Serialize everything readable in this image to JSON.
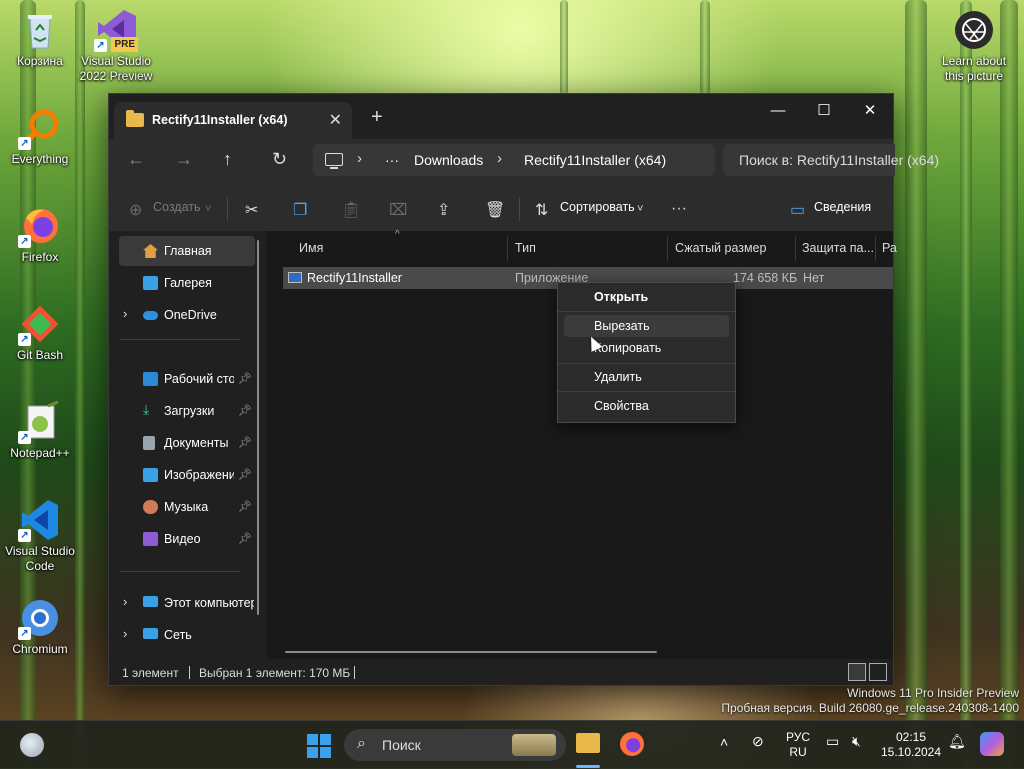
{
  "desktop": {
    "icons": [
      {
        "label": "Корзина"
      },
      {
        "label": "Visual Studio 2022 Preview",
        "badge": "PRE"
      },
      {
        "label": "Everything"
      },
      {
        "label": "Firefox"
      },
      {
        "label": "Git Bash"
      },
      {
        "label": "Notepad++"
      },
      {
        "label": "Visual Studio Code"
      },
      {
        "label": "Chromium"
      },
      {
        "label": "Learn about this picture"
      }
    ],
    "watermark": {
      "line1": "Windows 11 Pro Insider Preview",
      "line2": "Пробная версия. Build 26080.ge_release.240308-1400"
    }
  },
  "window": {
    "tab_title": "Rectify11Installer (x64)",
    "tab_close": "✕",
    "new_tab": "+",
    "controls": {
      "minimize": "—",
      "maximize": "☐",
      "close": "✕"
    },
    "nav": {
      "back": "←",
      "forward": "→",
      "up": "↑",
      "refresh": "↻"
    },
    "breadcrumb": [
      "Downloads",
      "Rectify11Installer (x64)"
    ],
    "breadcrumb_more": "···",
    "search_placeholder": "Поиск в: Rectify11Installer (x64)",
    "toolbar": {
      "create": "Создать",
      "sort": "Сортировать",
      "more": "···",
      "details": "Сведения"
    },
    "sidebar": {
      "items": [
        {
          "label": "Главная",
          "selected": true
        },
        {
          "label": "Галерея"
        },
        {
          "label": "OneDrive"
        },
        {
          "label": "Рабочий стол",
          "pinned": true
        },
        {
          "label": "Загрузки",
          "pinned": true
        },
        {
          "label": "Документы",
          "pinned": true
        },
        {
          "label": "Изображения",
          "pinned": true
        },
        {
          "label": "Музыка",
          "pinned": true
        },
        {
          "label": "Видео",
          "pinned": true
        },
        {
          "label": "Этот компьютер"
        },
        {
          "label": "Сеть"
        }
      ]
    },
    "columns": [
      "Имя",
      "Тип",
      "Сжатый размер",
      "Защита па...",
      "Ра"
    ],
    "files": [
      {
        "name": "Rectify11Installer",
        "type": "Приложение",
        "size": "174 658 КБ",
        "protected": "Нет"
      }
    ],
    "status": {
      "count": "1 элемент",
      "selection": "Выбран 1 элемент: 170 МБ"
    }
  },
  "context_menu": {
    "items": [
      "Открыть",
      "Вырезать",
      "Копировать",
      "Удалить",
      "Свойства"
    ],
    "hovered": "Вырезать"
  },
  "taskbar": {
    "search_label": "Поиск",
    "language": {
      "line1": "РУС",
      "line2": "RU"
    },
    "time": "02:15",
    "date": "15.10.2024"
  }
}
